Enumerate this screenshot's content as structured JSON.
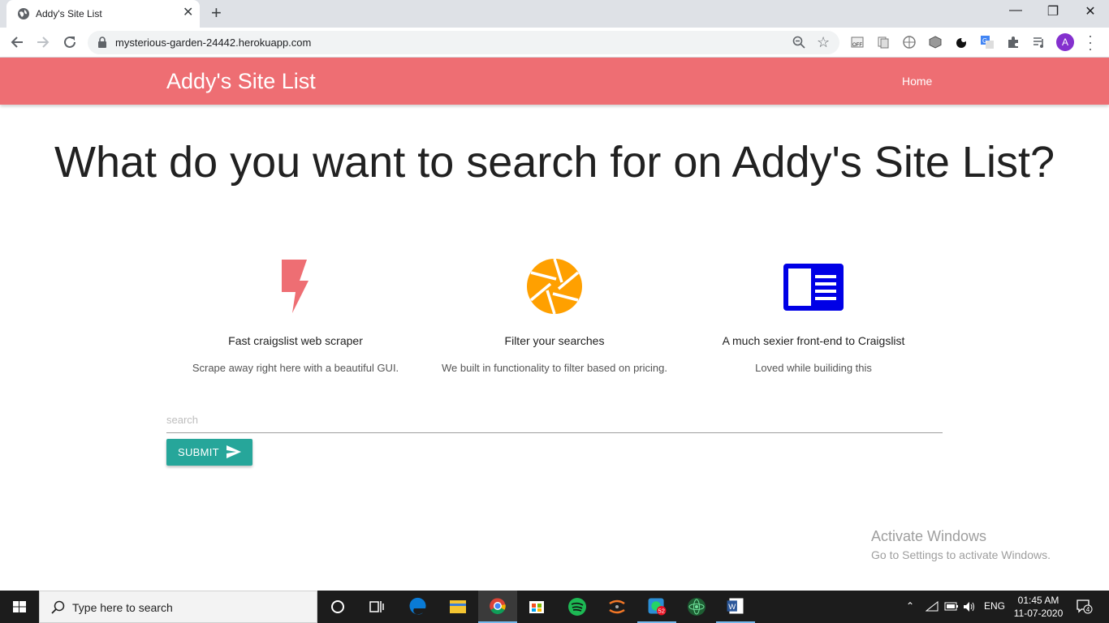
{
  "browser": {
    "tab_title": "Addy's Site List",
    "tab_close": "✕",
    "new_tab": "+",
    "url": "mysterious-garden-24442.herokuapp.com",
    "avatar_letter": "A",
    "minimize": "—",
    "maximize": "❐",
    "close": "✕"
  },
  "navbar": {
    "brand": "Addy's Site List",
    "home_link": "Home",
    "color": "#ee6e73"
  },
  "main": {
    "headline": "What do you want to search for on Addy's Site List?",
    "features": [
      {
        "icon": "flash-icon",
        "icon_color": "#ee6e73",
        "title": "Fast craigslist web scraper",
        "description": "Scrape away right here with a beautiful GUI."
      },
      {
        "icon": "camera-aperture-icon",
        "icon_color": "#ffa000",
        "title": "Filter your searches",
        "description": "We built in functionality to filter based on pricing."
      },
      {
        "icon": "chrome-reader-mode-icon",
        "icon_color": "#0000e6",
        "title": "A much sexier front-end to Craigslist",
        "description": "Loved while builiding this"
      }
    ],
    "search": {
      "placeholder": "search",
      "value": ""
    },
    "submit_label": "SUBMIT",
    "submit_color": "#26a69a"
  },
  "watermark": {
    "line1": "Activate Windows",
    "line2": "Go to Settings to activate Windows."
  },
  "taskbar": {
    "search_placeholder": "Type here to search",
    "whatsapp_badge": "52",
    "language": "ENG",
    "time": "01:45 AM",
    "date": "11-07-2020",
    "notifications": "4"
  }
}
